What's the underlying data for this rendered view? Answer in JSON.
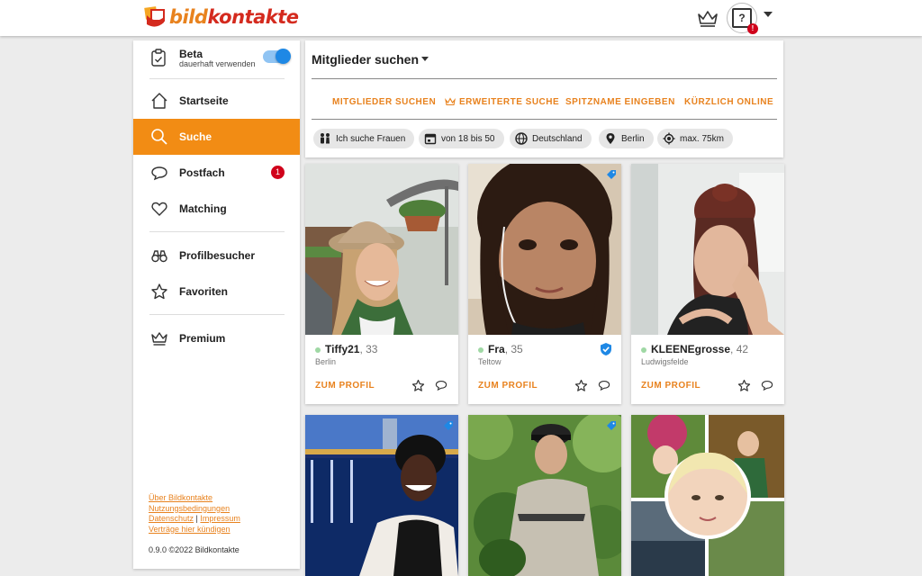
{
  "brand": {
    "part1": "bild",
    "part2": "kontakte"
  },
  "header": {
    "notification_badge": "!"
  },
  "sidebar": {
    "beta": {
      "title": "Beta",
      "subtitle": "dauerhaft verwenden",
      "enabled": true
    },
    "items": [
      {
        "label": "Startseite",
        "icon": "home-icon"
      },
      {
        "label": "Suche",
        "icon": "search-icon",
        "active": true
      },
      {
        "label": "Postfach",
        "icon": "chat-icon",
        "badge": "1"
      },
      {
        "label": "Matching",
        "icon": "heart-icon"
      },
      {
        "label": "Profilbesucher",
        "icon": "binoculars-icon"
      },
      {
        "label": "Favoriten",
        "icon": "star-icon"
      },
      {
        "label": "Premium",
        "icon": "crown-icon"
      }
    ],
    "footer": {
      "about": "Über Bildkontakte",
      "terms": "Nutzungsbedingungen",
      "privacy": "Datenschutz",
      "separator": "|",
      "imprint": "Impressum",
      "cancel": "Verträge hier kündigen",
      "version": "0.9.0 ©2022 Bildkontakte"
    }
  },
  "search": {
    "title": "Mitglieder suchen",
    "tabs": [
      "MITGLIEDER SUCHEN",
      "ERWEITERTE SUCHE",
      "SPITZNAME EINGEBEN",
      "KÜRZLICH ONLINE"
    ],
    "filters": [
      {
        "label": "Ich suche Frauen",
        "icon": "people-icon"
      },
      {
        "label": "von 18 bis 50",
        "icon": "calendar-icon"
      },
      {
        "label": "Deutschland",
        "icon": "globe-icon"
      },
      {
        "label": "Berlin",
        "icon": "location-pin-icon"
      },
      {
        "label": "max. 75km",
        "icon": "gps-target-icon"
      }
    ]
  },
  "cards": [
    {
      "name": "Tiffy21",
      "age": ", 33",
      "city": "Berlin",
      "cta": "ZUM PROFIL",
      "verified": false,
      "online": true
    },
    {
      "name": "Fra",
      "age": ", 35",
      "city": "Teltow",
      "cta": "ZUM PROFIL",
      "verified": true,
      "online": true
    },
    {
      "name": "KLEENEgrosse",
      "age": ", 42",
      "city": "Ludwigsfelde",
      "cta": "ZUM PROFIL",
      "verified": false,
      "online": true
    }
  ],
  "colors": {
    "accent": "#f28c14",
    "link": "#e8821e",
    "badge": "#d0021b",
    "toggle": "#1e88e5",
    "verified": "#1e88e5"
  }
}
